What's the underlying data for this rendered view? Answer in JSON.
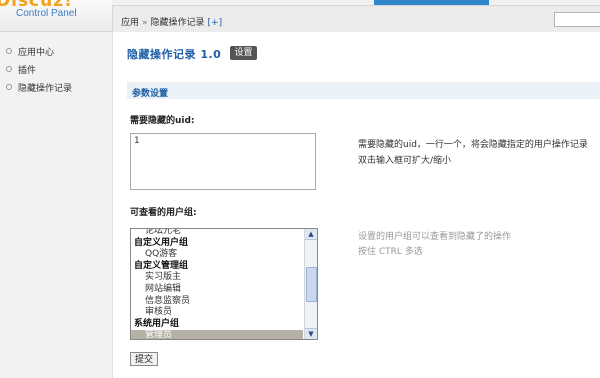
{
  "app": {
    "logo_text": "Discuz!",
    "panel_name": "Control Panel"
  },
  "breadcrumb": {
    "root": "应用",
    "separator": "»",
    "current": "隐藏操作记录",
    "add": "[+]"
  },
  "sidebar": {
    "items": [
      {
        "label": "应用中心"
      },
      {
        "label": "插件"
      },
      {
        "label": "隐藏操作记录"
      }
    ]
  },
  "page": {
    "title": "隐藏操作记录 1.0",
    "settings_button": "设置"
  },
  "section": {
    "title": "参数设置"
  },
  "uid_field": {
    "label": "需要隐藏的uid:",
    "value": "1",
    "hint_line1": "需要隐藏的uid，一行一个，将会隐藏指定的用户操作记录",
    "hint_line2": "双击输入框可扩大/缩小"
  },
  "groups_field": {
    "label": "可查看的用户组:",
    "hint_line1": "设置的用户组可以查看到隐藏了的操作",
    "hint_line2": "按住 CTRL 多选",
    "options": [
      {
        "label": "论坛元老",
        "type": "item"
      },
      {
        "label": "自定义用户组",
        "type": "group"
      },
      {
        "label": "QQ游客",
        "type": "item"
      },
      {
        "label": "自定义管理组",
        "type": "group"
      },
      {
        "label": "实习版主",
        "type": "item"
      },
      {
        "label": "网站编辑",
        "type": "item"
      },
      {
        "label": "信息监察员",
        "type": "item"
      },
      {
        "label": "审核员",
        "type": "item"
      },
      {
        "label": "系统用户组",
        "type": "group"
      },
      {
        "label": "管理员",
        "type": "selected"
      }
    ]
  },
  "form": {
    "submit_label": "提交"
  },
  "colors": {
    "accent": "#2f86c8",
    "title_blue": "#1f5fa8",
    "section_bg": "#e9f0f6",
    "selected_bg": "#b6b1a6"
  }
}
